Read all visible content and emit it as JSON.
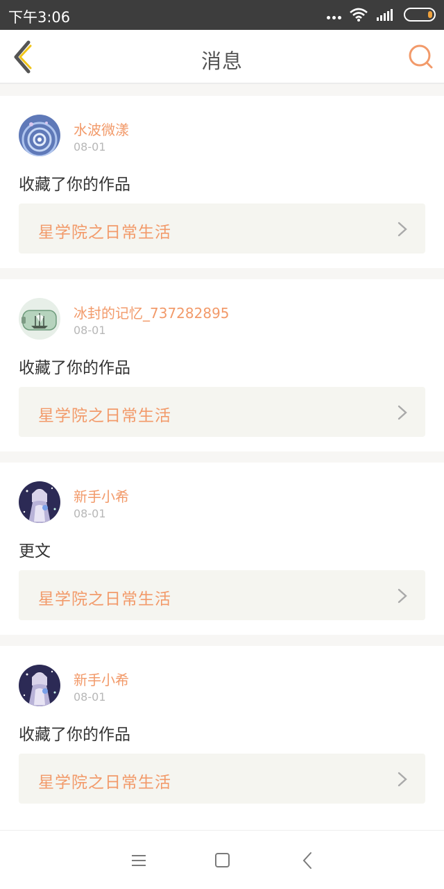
{
  "status_bar": {
    "time": "下午3:06"
  },
  "header": {
    "title": "消息",
    "back_icon": "chevron-left-icon",
    "search_icon": "search-icon",
    "accent_color": "#f29a6a"
  },
  "messages": [
    {
      "username": "水波微漾",
      "date": "08-01",
      "action": "收藏了你的作品",
      "work_title": "星学院之日常生活"
    },
    {
      "username": "冰封的记忆_737282895",
      "date": "08-01",
      "action": "收藏了你的作品",
      "work_title": "星学院之日常生活"
    },
    {
      "username": "新手小希",
      "date": "08-01",
      "action": "更文",
      "work_title": "星学院之日常生活"
    },
    {
      "username": "新手小希",
      "date": "08-01",
      "action": "收藏了你的作品",
      "work_title": "星学院之日常生活"
    }
  ],
  "nav_bar": {
    "menu_icon": "menu-icon",
    "home_icon": "home-square-icon",
    "back_icon": "back-triangle-icon"
  }
}
